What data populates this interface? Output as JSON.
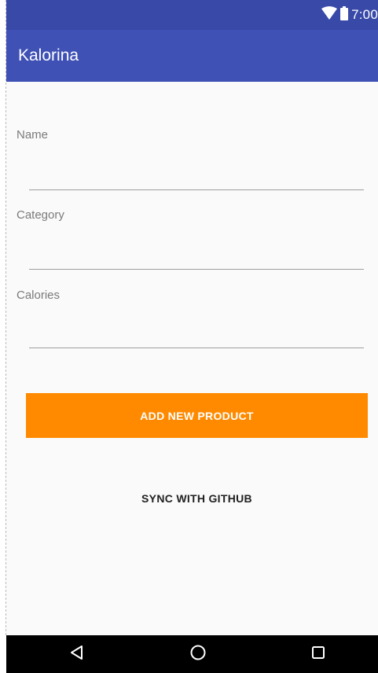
{
  "status_bar": {
    "time": "7:00",
    "icons": [
      "wifi-icon",
      "battery-icon"
    ]
  },
  "app_bar": {
    "title": "Kalorina"
  },
  "form": {
    "name_label": "Name",
    "name_value": "",
    "category_label": "Category",
    "category_value": "",
    "calories_label": "Calories",
    "calories_value": ""
  },
  "buttons": {
    "add_label": "ADD NEW PRODUCT",
    "sync_label": "SYNC WITH GITHUB"
  },
  "nav_bar": {
    "icons": [
      "back-icon",
      "home-icon",
      "recents-icon"
    ]
  },
  "colors": {
    "status_bar": "#3849a8",
    "app_bar": "#3f51b5",
    "accent": "#ff8a00",
    "background": "#fafafa",
    "nav_bar": "#000000"
  }
}
